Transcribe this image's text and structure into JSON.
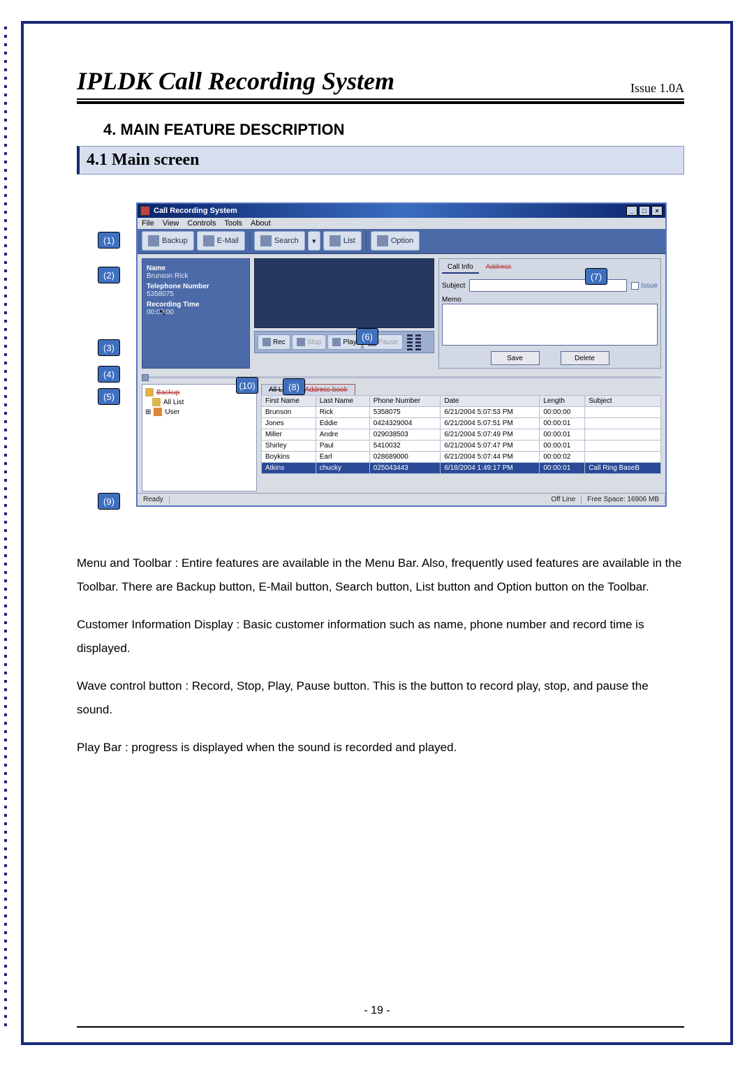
{
  "doc": {
    "title": "IPLDK Call Recording System",
    "issue": "Issue 1.0A",
    "section": "4.  MAIN FEATURE DESCRIPTION",
    "subsection": "4.1 Main screen",
    "page_number": "- 19 -"
  },
  "callouts": {
    "c1": "(1)",
    "c2": "(2)",
    "c3": "(3)",
    "c4": "(4)",
    "c5": "(5)",
    "c6": "(6)",
    "c7": "(7)",
    "c8": "(8)",
    "c9": "(9)",
    "c10": "(10)"
  },
  "app": {
    "title": "Call Recording System",
    "menu": {
      "file": "File",
      "view": "View",
      "controls": "Controls",
      "tools": "Tools",
      "about": "About"
    },
    "toolbar": {
      "backup": "Backup",
      "email": "E-Mail",
      "search": "Search",
      "list": "List",
      "option": "Option"
    },
    "customer": {
      "name_label": "Name",
      "name_value": "Brunson  Rick",
      "tel_label": "Telephone Number",
      "tel_value": "5358075",
      "rec_label": "Recording Time",
      "rec_value": "00:00:00"
    },
    "wave_btns": {
      "rec": "Rec",
      "stop": "Stop",
      "play": "Play",
      "pause": "Pause"
    },
    "right": {
      "tab_call": "Call Info",
      "tab_addr": "Address",
      "subject": "Subject",
      "issue": "Issue",
      "memo": "Memo",
      "save": "Save",
      "delete": "Delete"
    },
    "tree": {
      "backup": "Backup",
      "all_list": "All List",
      "user": "User",
      "expand": "⊞"
    },
    "list_tabs": {
      "main": "All List",
      "addr": "Address book"
    },
    "columns": {
      "first": "First Name",
      "last": "Last Name",
      "phone": "Phone Number",
      "date": "Date",
      "length": "Length",
      "subject": "Subject"
    },
    "rows": [
      {
        "first": "Brunson",
        "last": "Rick",
        "phone": "5358075",
        "date": "6/21/2004 5:07:53 PM",
        "length": "00:00:00",
        "subject": ""
      },
      {
        "first": "Jones",
        "last": "Eddie",
        "phone": "0424329004",
        "date": "6/21/2004 5:07:51 PM",
        "length": "00:00:01",
        "subject": ""
      },
      {
        "first": "Miller",
        "last": "Andre",
        "phone": "029038503",
        "date": "6/21/2004 5:07:49 PM",
        "length": "00:00:01",
        "subject": ""
      },
      {
        "first": "Shirley",
        "last": "Paul",
        "phone": "5410032",
        "date": "6/21/2004 5:07:47 PM",
        "length": "00:00:01",
        "subject": ""
      },
      {
        "first": "Boykins",
        "last": "Earl",
        "phone": "028689000",
        "date": "6/21/2004 5:07:44 PM",
        "length": "00:00:02",
        "subject": ""
      },
      {
        "first": "Atkins",
        "last": "chucky",
        "phone": "025043443",
        "date": "6/18/2004 1:49:17 PM",
        "length": "00:00:01",
        "subject": "Call Ring BaseB"
      }
    ],
    "status": {
      "ready": "Ready",
      "offline": "Off Line",
      "freespace": "Free Space: 16906  MB"
    }
  },
  "paragraphs": {
    "p1": "Menu and Toolbar : Entire features are available in the Menu Bar. Also, frequently used features are available in the Toolbar. There are Backup button, E-Mail button, Search button, List button and Option button on the Toolbar.",
    "p2": "Customer Information Display : Basic customer information such as name, phone number and record time is displayed.",
    "p3": "Wave control button  : Record, Stop, Play, Pause button. This is the button to record play, stop, and pause the sound.",
    "p4": "Play Bar : progress is displayed when the sound is recorded and played."
  }
}
